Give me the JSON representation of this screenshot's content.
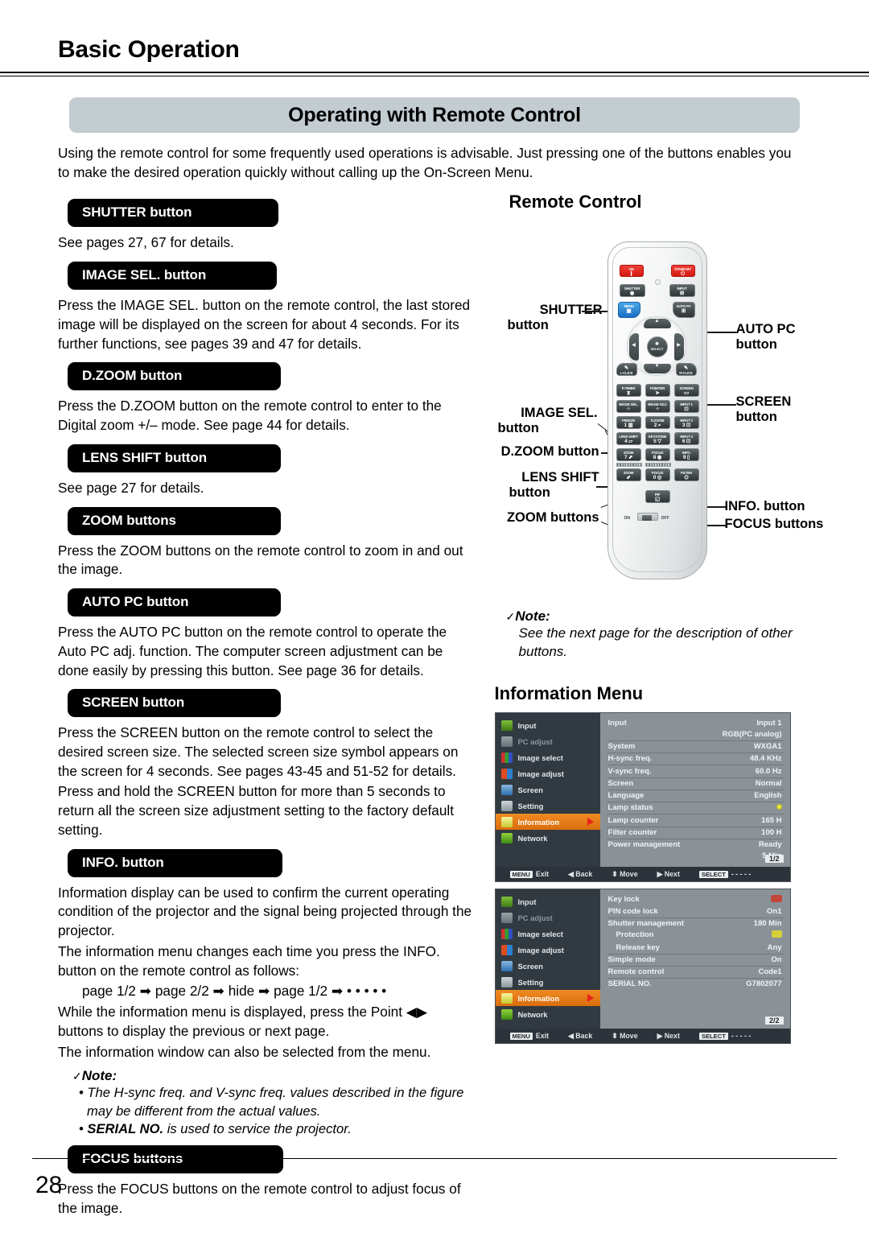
{
  "header": {
    "section_title": "Basic Operation"
  },
  "title_band": {
    "text": "Operating with Remote Control"
  },
  "intro": "Using the remote control for some frequently used operations is advisable. Just pressing one of the buttons enables you to make the desired operation quickly without calling up the On-Screen Menu.",
  "sections": [
    {
      "heading": "SHUTTER button",
      "paras": [
        "See pages 27, 67 for details."
      ]
    },
    {
      "heading": "IMAGE SEL. button",
      "paras": [
        "Press the IMAGE SEL. button on the remote control, the last stored image will be displayed on the screen for about 4 seconds. For its further functions, see pages 39 and 47 for details."
      ]
    },
    {
      "heading": "D.ZOOM button",
      "paras": [
        "Press the D.ZOOM button on the remote control to enter to the Digital zoom +/– mode. See page 44 for details."
      ]
    },
    {
      "heading": "LENS SHIFT button",
      "paras": [
        "See page 27 for details."
      ]
    },
    {
      "heading": "ZOOM buttons",
      "paras": [
        "Press the ZOOM buttons on the remote control to zoom in and out the image."
      ]
    },
    {
      "heading": "AUTO PC button",
      "paras": [
        "Press the AUTO PC button on the remote control to operate the Auto PC adj. function. The computer screen adjustment can be done easily by pressing this button. See page 36 for details."
      ]
    },
    {
      "heading": "SCREEN button",
      "paras": [
        "Press the SCREEN button on the remote control to select the desired screen size. The selected screen size symbol appears on the screen for 4 seconds. See pages 43-45 and 51-52 for details.",
        "Press and hold the SCREEN button for more than 5 seconds to return all the screen size adjustment setting to the factory default setting."
      ]
    },
    {
      "heading": "INFO. button",
      "paras": [
        "Information display can be used to confirm the current operating condition of the projector and the signal being projected through the projector.",
        "The information menu changes each time you press the INFO. button on the remote control as follows:"
      ]
    },
    {
      "heading": "FOCUS buttons",
      "paras": [
        "Press the FOCUS buttons on the remote control to adjust focus of the image."
      ]
    }
  ],
  "info_cycle": "page 1/2 ➡ page 2/2 ➡ hide ➡ page 1/2 ➡ • • • • •",
  "info_after": [
    "While the information menu is displayed, press the Point ◀▶ buttons to display the previous or next page.",
    "The information window can also be selected from the menu."
  ],
  "left_note": {
    "title": "Note:",
    "check": "✓",
    "items": [
      "The H-sync freq. and V-sync freq. values described in the figure may be different from the actual values.",
      "SERIAL NO. is used to service the projector."
    ],
    "item2_bold": "SERIAL NO.",
    "item2_rest": " is used to service the projector."
  },
  "remote": {
    "title": "Remote Control",
    "callouts": {
      "shutter": "SHUTTER\nbutton",
      "shutter_l1": "SHUTTER",
      "shutter_l2": "button",
      "image_sel_l1": "IMAGE SEL.",
      "image_sel_l2": "button",
      "dzoom": "D.ZOOM button",
      "lens_shift_l1": "LENS SHIFT",
      "lens_shift_l2": "button",
      "zoom": "ZOOM buttons",
      "auto_pc_l1": "AUTO PC",
      "auto_pc_l2": "button",
      "screen_l1": "SCREEN",
      "screen_l2": "button",
      "info": "INFO. button",
      "focus": "FOCUS buttons"
    },
    "keys": {
      "on": "ON",
      "standby": "STAND-BY",
      "shutter": "SHUTTER",
      "input": "INPUT",
      "menu": "MENU",
      "auto_pc": "AUTO PC",
      "select": "SELECT",
      "l_click": "L-CLICK",
      "r_click": "R-CLICK",
      "p_timer": "P-TIMER",
      "pointer": "POINTER",
      "screen": "SCREEN",
      "image_sel": "IMAGE SEL.",
      "image_adj": "IMAGE ADJ.",
      "input1": "INPUT 1",
      "freeze": "FREEZE",
      "dzoom": "D.ZOOM",
      "input2": "INPUT 2",
      "lens_shift": "LENS SHIFT",
      "keystone": "KEYSTONE",
      "input3": "INPUT 3",
      "zoom_up": "ZOOM",
      "focus_up": "FOCUS",
      "info": "INFO.",
      "zoom_dn": "ZOOM",
      "focus_dn": "FOCUS",
      "filter": "FILTER",
      "pip": "PIP",
      "slider_on": "ON",
      "slider_off": "OFF",
      "n1": "1",
      "n2": "2",
      "n3": "3",
      "n4": "4",
      "n5": "5",
      "n6": "6",
      "n7": "7",
      "n8": "8",
      "n9": "9",
      "n0": "0"
    }
  },
  "right_note": {
    "check": "✓",
    "title": "Note:",
    "body": "See the next page for the description of other buttons."
  },
  "information_menu": {
    "title": "Information Menu",
    "sidebar": [
      {
        "label": "Input",
        "state": "normal"
      },
      {
        "label": "PC adjust",
        "state": "dim"
      },
      {
        "label": "Image select",
        "state": "normal"
      },
      {
        "label": "Image adjust",
        "state": "normal"
      },
      {
        "label": "Screen",
        "state": "normal"
      },
      {
        "label": "Setting",
        "state": "normal"
      },
      {
        "label": "Information",
        "state": "active"
      },
      {
        "label": "Network",
        "state": "normal"
      }
    ],
    "page1": {
      "rows": [
        {
          "key": "Input",
          "value": "Input 1"
        },
        {
          "key": "",
          "value": "RGB(PC analog)"
        },
        {
          "key": "System",
          "value": "WXGA1"
        },
        {
          "key": "H-sync freq.",
          "value": "48.4 KHz"
        },
        {
          "key": "V-sync freq.",
          "value": "60.0 Hz"
        },
        {
          "key": "Screen",
          "value": "Normal"
        },
        {
          "key": "Language",
          "value": "English"
        },
        {
          "key": "Lamp status",
          "value": ""
        },
        {
          "key": "Lamp counter",
          "value": "165 H"
        },
        {
          "key": "Filter counter",
          "value": "100 H"
        },
        {
          "key": "Power management",
          "value": "Ready"
        },
        {
          "key": "",
          "value": "5 Min"
        }
      ],
      "page_badge": "1/2"
    },
    "page2": {
      "rows": [
        {
          "key": "Key lock",
          "value": ""
        },
        {
          "key": "PIN code lock",
          "value": "On1"
        },
        {
          "key": "Shutter management",
          "value": "180 Min"
        },
        {
          "key": "Protection",
          "value": ""
        },
        {
          "key": "Release key",
          "value": "Any"
        },
        {
          "key": "Simple mode",
          "value": "On"
        },
        {
          "key": "Remote control",
          "value": "Code1"
        },
        {
          "key": "SERIAL NO.",
          "value": "G7802077"
        }
      ],
      "page_badge": "2/2"
    },
    "footer": {
      "exit_key": "MENU",
      "exit": "Exit",
      "back": "◀ Back",
      "move": "⬍ Move",
      "next": "▶ Next",
      "select_key": "SELECT",
      "select": "- - - - -"
    }
  },
  "page_number": "28"
}
